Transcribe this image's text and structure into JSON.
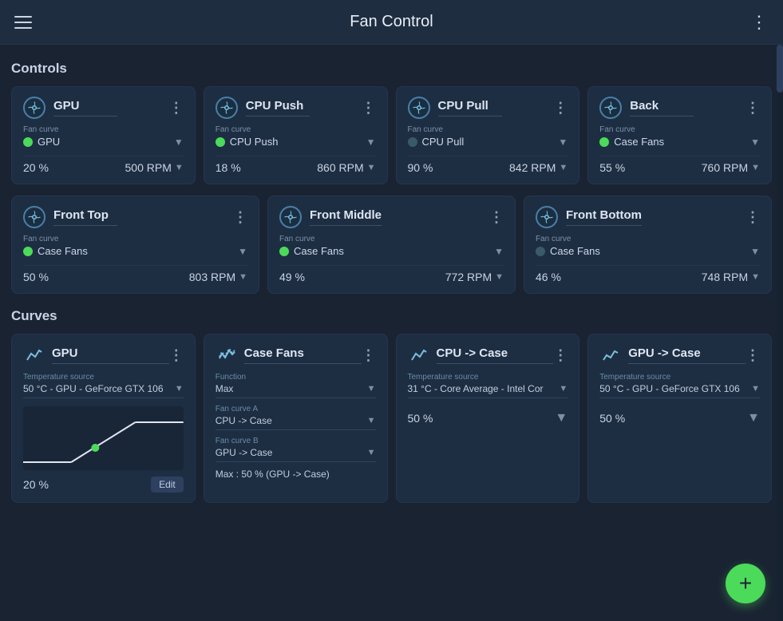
{
  "header": {
    "title": "Fan Control",
    "menu_icon": "☰",
    "dots_icon": "⋮"
  },
  "sections": {
    "controls_label": "Controls",
    "curves_label": "Curves"
  },
  "controls": [
    {
      "id": "gpu",
      "name": "GPU",
      "fan_curve_label": "Fan curve",
      "fan_curve": "GPU",
      "percent": "20 %",
      "rpm": "500 RPM",
      "active": true
    },
    {
      "id": "cpu-push",
      "name": "CPU Push",
      "fan_curve_label": "Fan curve",
      "fan_curve": "CPU Push",
      "percent": "18 %",
      "rpm": "860 RPM",
      "active": true
    },
    {
      "id": "cpu-pull",
      "name": "CPU Pull",
      "fan_curve_label": "Fan curve",
      "fan_curve": "CPU Pull",
      "percent": "90 %",
      "rpm": "842 RPM",
      "active": false
    },
    {
      "id": "back",
      "name": "Back",
      "fan_curve_label": "Fan curve",
      "fan_curve": "Case Fans",
      "percent": "55 %",
      "rpm": "760 RPM",
      "active": true
    }
  ],
  "controls_row2": [
    {
      "id": "front-top",
      "name": "Front Top",
      "fan_curve_label": "Fan curve",
      "fan_curve": "Case Fans",
      "percent": "50 %",
      "rpm": "803 RPM",
      "active": true
    },
    {
      "id": "front-middle",
      "name": "Front Middle",
      "fan_curve_label": "Fan curve",
      "fan_curve": "Case Fans",
      "percent": "49 %",
      "rpm": "772 RPM",
      "active": true
    },
    {
      "id": "front-bottom",
      "name": "Front Bottom",
      "fan_curve_label": "Fan curve",
      "fan_curve": "Case Fans",
      "percent": "46 %",
      "rpm": "748 RPM",
      "active": false
    }
  ],
  "curves": [
    {
      "id": "gpu-curve",
      "name": "GPU",
      "temp_source_label": "Temperature source",
      "temp_source": "50 °C - GPU - GeForce GTX 106",
      "percent_label": "20 %",
      "edit_label": "Edit",
      "has_chart": true
    },
    {
      "id": "case-fans-curve",
      "name": "Case Fans",
      "function_label": "Function",
      "function_val": "Max",
      "fan_curve_a_label": "Fan curve A",
      "fan_curve_a_val": "CPU -> Case",
      "fan_curve_b_label": "Fan curve B",
      "fan_curve_b_val": "GPU -> Case",
      "max_label": "Max : 50 % (GPU -> Case)"
    },
    {
      "id": "cpu-case-curve",
      "name": "CPU -> Case",
      "temp_source_label": "Temperature source",
      "temp_source": "31 °C - Core Average - Intel Cor",
      "percent_label": "50 %"
    },
    {
      "id": "gpu-case-curve",
      "name": "GPU -> Case",
      "temp_source_label": "Temperature source",
      "temp_source": "50 °C - GPU - GeForce GTX 106",
      "percent_label": "50 %"
    }
  ],
  "fab": {
    "label": "+"
  }
}
